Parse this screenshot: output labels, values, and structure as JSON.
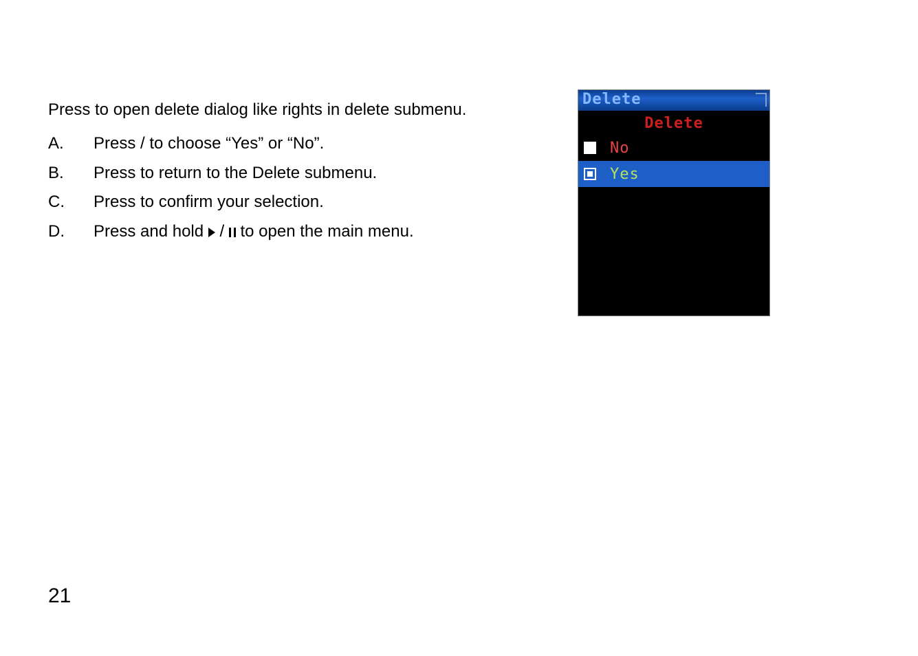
{
  "intro": "Press          to open delete dialog like rights in delete submenu.",
  "steps": [
    {
      "label": "A.",
      "text": "Press     /    to choose “Yes” or “No”."
    },
    {
      "label": "B.",
      "text": "Press               to return to the Delete submenu."
    },
    {
      "label": "C.",
      "text": "Press          to confirm your selection."
    },
    {
      "label": "D.",
      "text_before": "Press and hold        ",
      "text_after": "  to open the main menu.",
      "has_icon": true
    }
  ],
  "screenshot": {
    "titlebar": "Delete",
    "heading": "Delete",
    "options": [
      {
        "label": "No",
        "selected": false
      },
      {
        "label": "Yes",
        "selected": true
      }
    ]
  },
  "page_number": "21"
}
